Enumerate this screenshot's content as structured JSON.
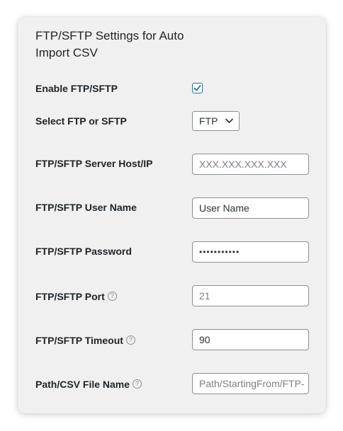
{
  "panel": {
    "title": "FTP/SFTP Settings for Auto Import CSV"
  },
  "fields": {
    "enable": {
      "label": "Enable FTP/SFTP",
      "checked": true
    },
    "type": {
      "label": "Select FTP or SFTP",
      "value": "FTP",
      "icon": "chevron-down-icon"
    },
    "host": {
      "label": "FTP/SFTP Server Host/IP",
      "value": "",
      "placeholder": "XXX.XXX.XXX.XXX"
    },
    "username": {
      "label": "FTP/SFTP User Name",
      "value": "User Name"
    },
    "password": {
      "label": "FTP/SFTP Password",
      "value": "•••••••••••"
    },
    "port": {
      "label": "FTP/SFTP Port",
      "value": "",
      "placeholder": "21",
      "help_icon": "help-icon"
    },
    "timeout": {
      "label": "FTP/SFTP Timeout",
      "value": "90",
      "help_icon": "help-icon"
    },
    "path": {
      "label": "Path/CSV File Name",
      "value": "",
      "placeholder": "Path/StartingFrom/FTP-",
      "help_icon": "help-icon"
    }
  },
  "colors": {
    "panel_bg": "#f0f0f1",
    "accent": "#2271b1",
    "border": "#8c8f94",
    "text": "#1d2327"
  }
}
